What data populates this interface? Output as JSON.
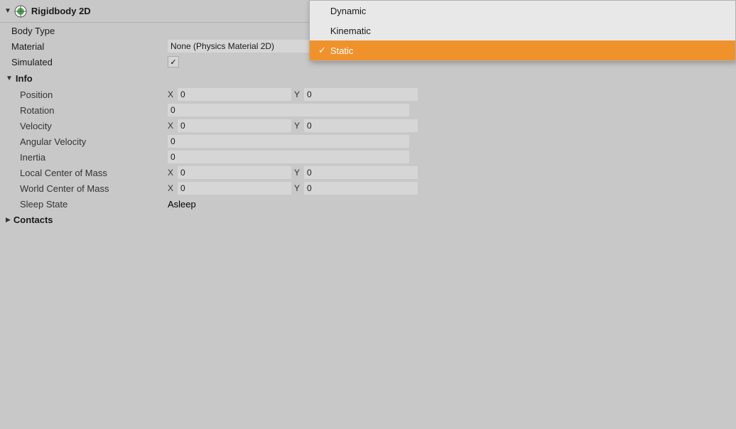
{
  "header": {
    "title": "Rigidbody 2D",
    "arrow": "▼"
  },
  "dropdown": {
    "items": [
      {
        "label": "Dynamic",
        "selected": false
      },
      {
        "label": "Kinematic",
        "selected": false
      },
      {
        "label": "Static",
        "selected": true
      }
    ]
  },
  "rows": {
    "body_type_label": "Body Type",
    "material_label": "Material",
    "material_value": "None (Physics Material 2D)",
    "simulated_label": "Simulated",
    "info_label": "Info",
    "position_label": "Position",
    "position_x": "0",
    "position_y": "0",
    "rotation_label": "Rotation",
    "rotation_value": "0",
    "velocity_label": "Velocity",
    "velocity_x": "0",
    "velocity_y": "0",
    "angular_velocity_label": "Angular Velocity",
    "angular_velocity_value": "0",
    "inertia_label": "Inertia",
    "inertia_value": "0",
    "local_com_label": "Local Center of Mass",
    "local_com_x": "0",
    "local_com_y": "0",
    "world_com_label": "World Center of Mass",
    "world_com_x": "0",
    "world_com_y": "0",
    "sleep_state_label": "Sleep State",
    "sleep_state_value": "Asleep",
    "contacts_label": "Contacts",
    "contacts_arrow": "▶",
    "x_label": "X",
    "y_label": "Y"
  },
  "icons": {
    "component_icon": "rigidbody-icon",
    "target_icon": "◎"
  }
}
